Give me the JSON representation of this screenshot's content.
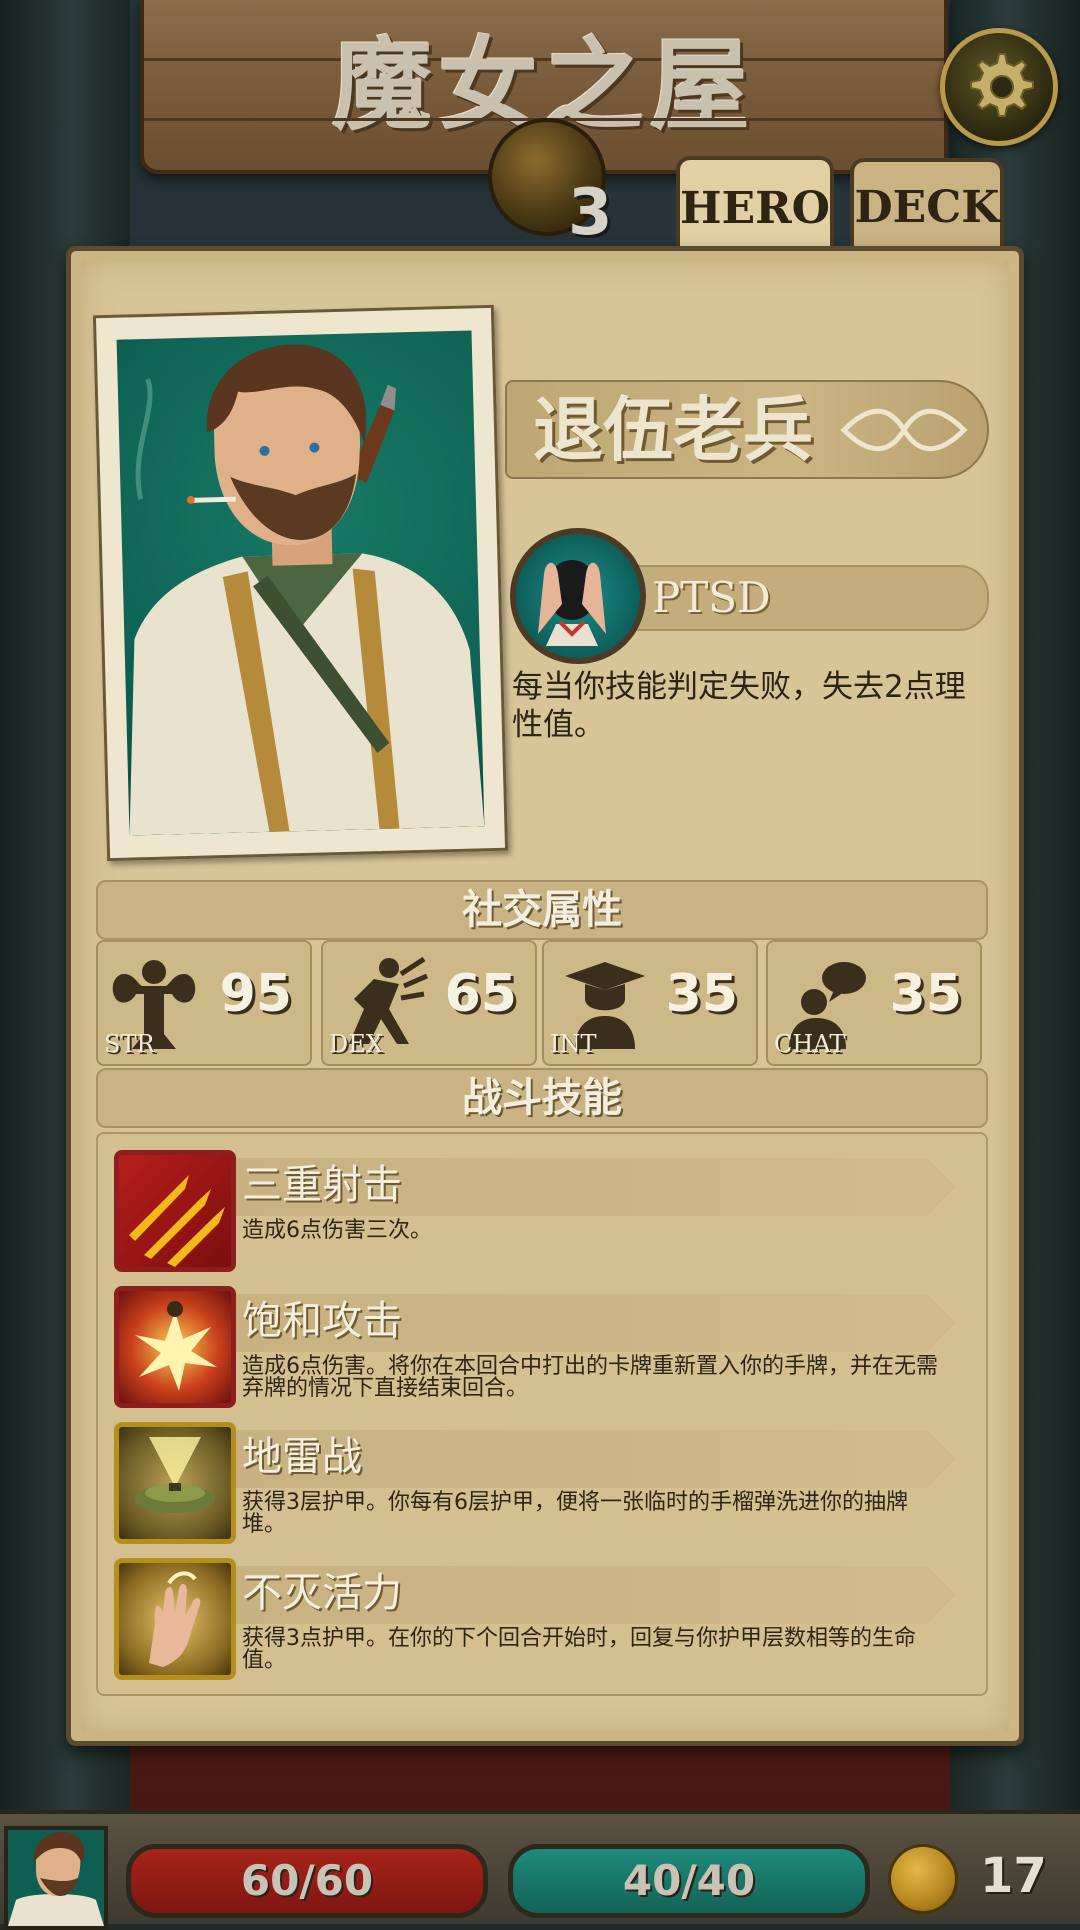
{
  "header": {
    "title": "魔女之屋",
    "level": "3",
    "settings_icon": "gear-icon"
  },
  "tabs": [
    {
      "label": "HERO",
      "active": true
    },
    {
      "label": "DECK",
      "active": false
    }
  ],
  "hero": {
    "name": "退伍老兵",
    "portrait_icon": "soldier-portrait",
    "trait": {
      "name": "PTSD",
      "icon": "head-in-hands-icon",
      "description": "每当你技能判定失败，失去2点理性值。"
    }
  },
  "social": {
    "header": "社交属性",
    "stats": [
      {
        "label": "STR",
        "value": "95",
        "icon": "muscle-icon"
      },
      {
        "label": "DEX",
        "value": "65",
        "icon": "running-icon"
      },
      {
        "label": "INT",
        "value": "35",
        "icon": "graduate-icon"
      },
      {
        "label": "CHAT",
        "value": "35",
        "icon": "speech-icon"
      }
    ]
  },
  "combat": {
    "header": "战斗技能",
    "skills": [
      {
        "name": "三重射击",
        "description": "造成6点伤害三次。",
        "icon": "triple-bullet-icon",
        "frame": "red"
      },
      {
        "name": "饱和攻击",
        "description": "造成6点伤害。将你在本回合中打出的卡牌重新置入你的手牌，并在无需弃牌的情况下直接结束回合。",
        "icon": "explosion-icon",
        "frame": "red"
      },
      {
        "name": "地雷战",
        "description": "获得3层护甲。你每有6层护甲，便将一张临时的手榴弹洗进你的抽牌堆。",
        "icon": "landmine-icon",
        "frame": "gold"
      },
      {
        "name": "不灭活力",
        "description": "获得3点护甲。在你的下个回合开始时，回复与你护甲层数相等的生命值。",
        "icon": "glowing-hand-icon",
        "frame": "gold"
      }
    ]
  },
  "hud": {
    "health": "60/60",
    "sanity": "40/40",
    "coins": "17",
    "colors": {
      "health": "#a8241a",
      "sanity": "#1f8a7c",
      "coin": "#e4b84a"
    }
  }
}
